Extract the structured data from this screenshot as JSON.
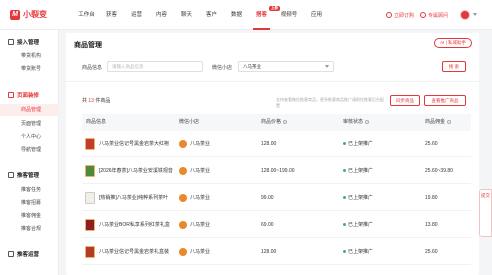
{
  "app": {
    "name": "小裂变",
    "logo_mark": "M"
  },
  "nav": [
    {
      "label": "工作台"
    },
    {
      "label": "获客"
    },
    {
      "label": "运营"
    },
    {
      "label": "内容"
    },
    {
      "label": "聊天"
    },
    {
      "label": "客户"
    },
    {
      "label": "数据"
    },
    {
      "label": "搭客",
      "active": true,
      "badge": "上新"
    },
    {
      "label": "视频号"
    },
    {
      "label": "应用"
    }
  ],
  "top_right": {
    "order": "立即订购",
    "consultant": "专属顾问"
  },
  "sidebar": {
    "groups": [
      {
        "label": "接入管理",
        "items": [
          "带货机构",
          "带货账号"
        ]
      },
      {
        "label": "页面装修",
        "active": true,
        "items": [
          "商品管理",
          "页面管理",
          "个人中心",
          "导航管理"
        ]
      },
      {
        "label": "推客管理",
        "items": [
          "推客任务",
          "推客招募",
          "推客佣金",
          "推客合规"
        ]
      },
      {
        "label": "推客运营",
        "items": []
      }
    ],
    "active_item": "商品管理"
  },
  "page": {
    "title": "商品管理",
    "ai_button": "AI | 私域助手",
    "filters": {
      "product_label": "商品信息",
      "product_placeholder": "请输入商品信息",
      "shop_label": "微信小店",
      "shop_value": "八马茶业",
      "search_button": "搜 索"
    },
    "count_prefix": "共",
    "count": "13",
    "count_suffix": "件商品",
    "note": "支持查看微信推客商品，更多推客商品推广请前往推客后台配置",
    "sync_button": "同步商品",
    "view_button": "查看推广商品",
    "columns": [
      "商品信息",
      "微信小店",
      "商品价格",
      "审核状态",
      "商品佣金"
    ]
  },
  "table": [
    {
      "name": "八马茶业信记号黑金岩茶大红袍",
      "shop": "八马茶业",
      "price": "128.00",
      "status": "已上架推广",
      "commission": "25.60"
    },
    {
      "name": "[2026年春茶]八马茶业安溪铁观音",
      "shop": "八马茶业",
      "price": "128.00~199.00",
      "status": "已上架推广",
      "commission": "25.60~39.80"
    },
    {
      "name": "[热销推]八马茶业|纯粹系列茶叶",
      "shop": "八马茶业",
      "price": "99.00",
      "status": "已上架推广",
      "commission": "19.80"
    },
    {
      "name": "八马茶业BOR私享系列红茶礼盒",
      "shop": "八马茶业",
      "price": "69.00",
      "status": "已上架推广",
      "commission": "13.80"
    },
    {
      "name": "八马茶业信记号黑金岩茶礼盒装",
      "shop": "八马茶业",
      "price": "128.00",
      "status": "已上架推广",
      "commission": "25.60"
    }
  ],
  "float_tab": "提交"
}
